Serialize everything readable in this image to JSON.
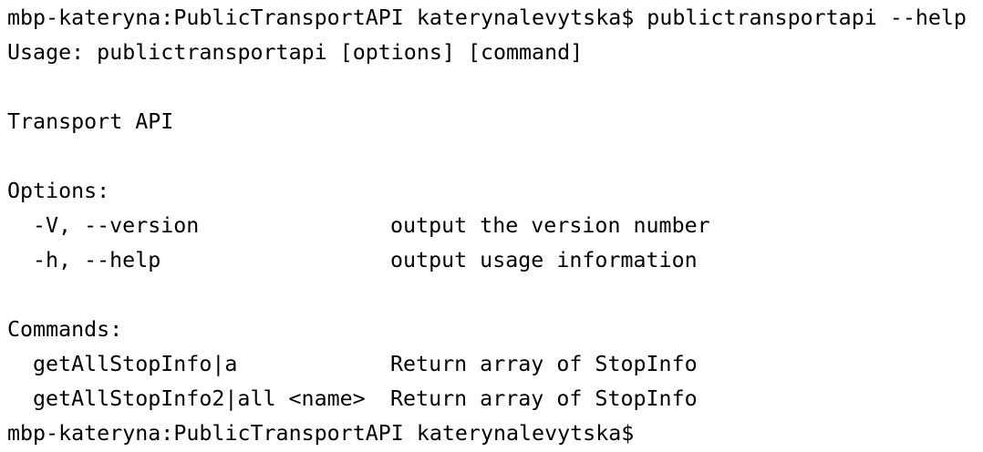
{
  "terminal": {
    "prompt_line_1": "mbp-kateryna:PublicTransportAPI katerynalevytska$ publictransportapi --help",
    "usage": "Usage: publictransportapi [options] [command]",
    "description": "Transport API",
    "options_header": "Options:",
    "options": [
      {
        "flag": "-V, --version",
        "desc": "output the version number"
      },
      {
        "flag": "-h, --help",
        "desc": "output usage information"
      }
    ],
    "commands_header": "Commands:",
    "commands": [
      {
        "name": "getAllStopInfo|a",
        "desc": "Return array of StopInfo"
      },
      {
        "name": "getAllStopInfo2|all <name>",
        "desc": "Return array of StopInfo"
      }
    ],
    "prompt_line_2": "mbp-kateryna:PublicTransportAPI katerynalevytska$"
  }
}
